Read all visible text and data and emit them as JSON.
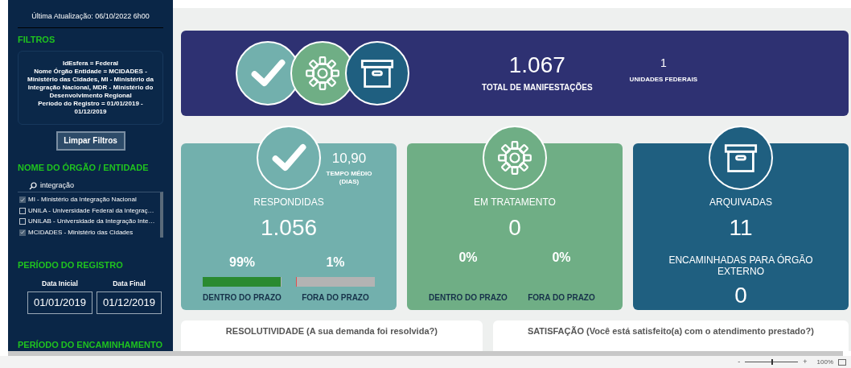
{
  "sidebar": {
    "last_update": "Última Atualização: 06/10/2022 6h00",
    "filters_title": "FILTROS",
    "filters_summary": [
      "IdEsfera = Federal",
      "Nome Órgão Entidade = MCIDADES - Ministério das Cidades, MI - Ministério da Integração Nacional, MDR - Ministério do Desenvolvimento Regional",
      "Período do Registro = 01/01/2019 - 01/12/2019"
    ],
    "clear_button": "Limpar Filtros",
    "org_title": "NOME DO ÓRGÃO / ENTIDADE",
    "org_search": "integração",
    "org_items": [
      {
        "label": "MI - Ministério da Integração Nacional",
        "checked": true
      },
      {
        "label": "UNILA - Universidade Federal da Integraç…",
        "checked": false
      },
      {
        "label": "UNILAB - Universidade da Integração Inte…",
        "checked": false
      },
      {
        "label": "MCIDADES - Ministério das Cidades",
        "checked": true
      }
    ],
    "period_title": "PERÍODO DO REGISTRO",
    "period_fields": [
      {
        "label": "Data Inicial",
        "value": "01/01/2019"
      },
      {
        "label": "Data Final",
        "value": "01/12/2019"
      }
    ],
    "forwarding_title": "PERÍODO DO ENCAMINHAMENTO"
  },
  "summary": {
    "total": "1.067",
    "total_label": "TOTAL DE MANIFESTAÇÕES",
    "units": "1",
    "units_label": "UNIDADES FEDERAIS"
  },
  "cards": [
    {
      "kind": "check",
      "color": "#72b0ad",
      "title": "RESPONDIDAS",
      "value": "1.056",
      "avg_time": "10,90",
      "avg_label": "TEMPO MÉDIO (DIAS)",
      "deadline": [
        {
          "pct": "99%",
          "label": "DENTRO DO PRAZO",
          "level": 0.99
        },
        {
          "pct": "1%",
          "label": "FORA DO PRAZO",
          "level": 0.01
        }
      ]
    },
    {
      "kind": "gear",
      "color": "#6fae85",
      "title": "EM TRATAMENTO",
      "value": "0",
      "deadline": [
        {
          "pct": "0%",
          "label": "DENTRO DO PRAZO"
        },
        {
          "pct": "0%",
          "label": "FORA DO PRAZO"
        }
      ]
    },
    {
      "kind": "box",
      "color": "#1f5f80",
      "title": "ARQUIVADAS",
      "value": "11",
      "sub_title": "ENCAMINHADAS PARA ÓRGÃO EXTERNO",
      "sub_value": "0"
    }
  ],
  "panels": [
    "RESOLUTIVIDADE (A sua demanda foi resolvida?)",
    "SATISFAÇÃO (Você está satisfeito(a) com o atendimento prestado?)"
  ],
  "zoom": {
    "minus": "-",
    "plus": "+",
    "level": 0.5,
    "reading": "100%"
  }
}
